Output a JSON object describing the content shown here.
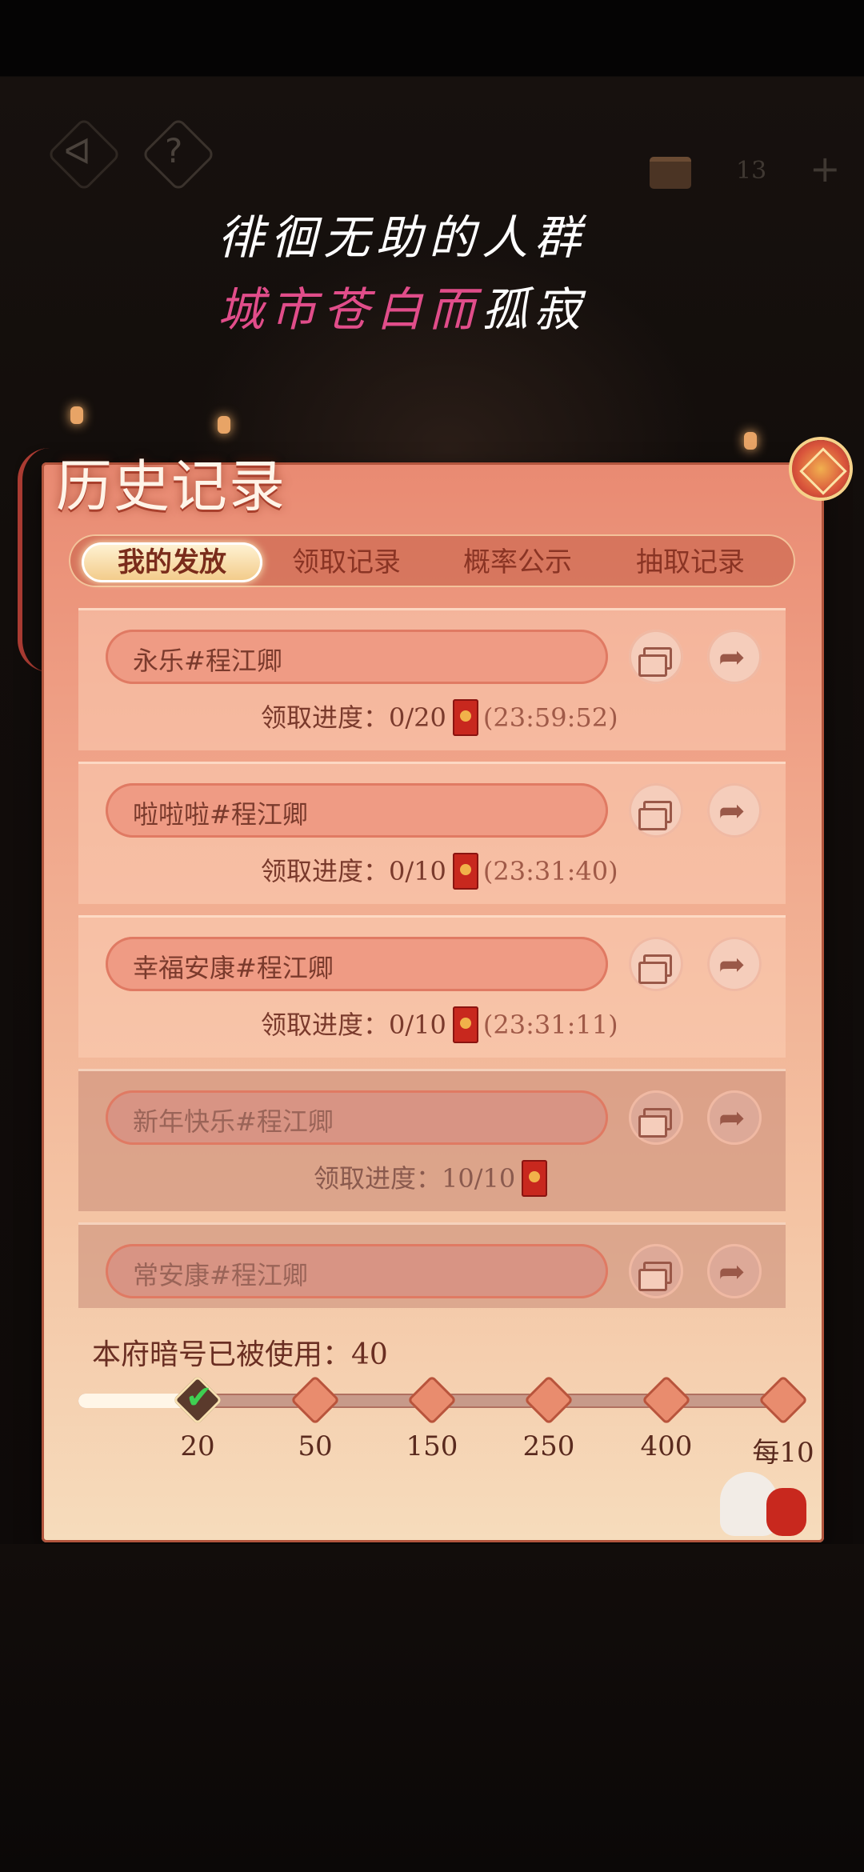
{
  "topbar": {
    "counter": "13",
    "icons": [
      "back-icon",
      "help-icon",
      "chest-icon",
      "plus-icon"
    ]
  },
  "lyrics": {
    "line1": "徘徊无助的人群",
    "line2_highlight": "城市苍白而",
    "line2_rest": "孤寂",
    "highlight_color": "#e14d8a"
  },
  "panel": {
    "title": "历史记录",
    "tabs": [
      {
        "label": "我的发放",
        "active": true
      },
      {
        "label": "领取记录",
        "active": false
      },
      {
        "label": "概率公示",
        "active": false
      },
      {
        "label": "抽取记录",
        "active": false
      }
    ],
    "items": [
      {
        "name": "永乐#程江卿",
        "progress_label": "领取进度：",
        "progress": "0/20",
        "timer": "(23:59:52)",
        "done": false
      },
      {
        "name": "啦啦啦#程江卿",
        "progress_label": "领取进度：",
        "progress": "0/10",
        "timer": "(23:31:40)",
        "done": false
      },
      {
        "name": "幸福安康#程江卿",
        "progress_label": "领取进度：",
        "progress": "0/10",
        "timer": "(23:31:11)",
        "done": false
      },
      {
        "name": "新年快乐#程江卿",
        "progress_label": "领取进度：",
        "progress": "10/10",
        "timer": "",
        "done": true
      },
      {
        "name": "常安康#程江卿",
        "progress_label": "",
        "progress": "",
        "timer": "",
        "done": true
      }
    ]
  },
  "usage": {
    "label": "本府暗号已被使用：40",
    "used_value": 40,
    "milestones": [
      "20",
      "50",
      "150",
      "250",
      "400",
      "每10"
    ],
    "reached_count": 1,
    "progress_fraction": 0.18
  },
  "colors": {
    "panel_top": "#e98a72",
    "panel_bottom": "#f6dcbc",
    "text_dark": "#7a3a2c",
    "envelope_red": "#c8281e"
  }
}
